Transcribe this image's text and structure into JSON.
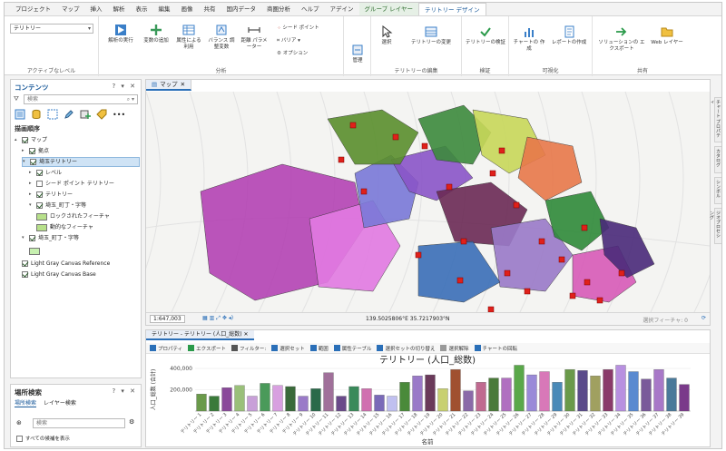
{
  "ribbon": {
    "tabs": [
      "プロジェクト",
      "マップ",
      "挿入",
      "解析",
      "表示",
      "編集",
      "画像",
      "共有",
      "国内データ",
      "商圏分析",
      "ヘルプ",
      "アデイン",
      "グループ レイヤー",
      "テリトリー デザイン"
    ],
    "active_tab": "テリトリー デザイン",
    "level_dropdown": "テリトリー",
    "level_group_label": "アクティブなレベル",
    "buttons": {
      "run_solve": "解析の実行",
      "add_variable": "変数の追加",
      "attribute_balance": "属性による 利用",
      "balance_variable": "バランス 調整変数",
      "distance_param": "距離 パラメーター",
      "seed_point": "シード ポイント",
      "barrier": "バリア",
      "options": "オプション",
      "manage": "管理",
      "select": "選択",
      "change_territory": "テリトリーの変更",
      "verify_territory": "テリトリーの検証",
      "create_chart": "チャートの 作成",
      "create_report": "レポートの作成",
      "export_solution": "ソリューションの エクスポート",
      "web_layer": "Web レイヤー"
    },
    "group_labels": {
      "analysis": "分析",
      "territory_edit": "テリトリーの編集",
      "verify": "検証",
      "visualize": "可視化",
      "share": "共有"
    }
  },
  "contents": {
    "title": "コンテンツ",
    "search_placeholder": "検索",
    "section": "描画順序",
    "items": [
      {
        "label": "マップ",
        "indent": 0,
        "checked": true,
        "twisty": "▴"
      },
      {
        "label": "拠点",
        "indent": 1,
        "checked": true,
        "twisty": "▸"
      },
      {
        "label": "埼玉テリトリー",
        "indent": 1,
        "checked": true,
        "twisty": "▾",
        "selected": true
      },
      {
        "label": "レベル",
        "indent": 2,
        "checked": true,
        "twisty": "▸"
      },
      {
        "label": "シード ポイント テリトリー",
        "indent": 2,
        "checked": false,
        "twisty": "▸"
      },
      {
        "label": "テリトリー",
        "indent": 2,
        "checked": true,
        "twisty": "▸"
      },
      {
        "label": "埼玉_町丁・字等",
        "indent": 2,
        "checked": true,
        "twisty": "▾"
      },
      {
        "label": "ロックされたフィーチャ",
        "indent": 3,
        "swatch": "#b7e08a"
      },
      {
        "label": "動的なフィーチャ",
        "indent": 3,
        "swatch": "#b7e08a"
      },
      {
        "label": "埼玉_町丁・字等",
        "indent": 1,
        "checked": true,
        "twisty": "▾"
      },
      {
        "label": "",
        "indent": 2,
        "swatch": "#c7f0b0"
      },
      {
        "label": "Light Gray Canvas Reference",
        "indent": 1,
        "checked": true
      },
      {
        "label": "Light Gray Canvas Base",
        "indent": 1,
        "checked": true
      }
    ]
  },
  "locate": {
    "title": "場所検索",
    "tabs": [
      "場所検索",
      "レイヤー検索"
    ],
    "search_placeholder": "検索",
    "show_all": "すべての候補を表示"
  },
  "map": {
    "tab_label": "マップ",
    "scale": "1:647,003",
    "coords": "139.5025806°E 35.7217903°N",
    "selected_features": "選択フィーチャ: 0"
  },
  "chart_view": {
    "tab_label": "テリトリー - テリトリー (人口_総数)",
    "toolbar": [
      "プロパティ",
      "エクスポート",
      "フィルター:",
      "選択セット",
      "範囲",
      "属性テーブル",
      "選択セットの切り替え",
      "選択解除",
      "チャートの回転"
    ]
  },
  "chart_data": {
    "type": "bar",
    "title": "テリトリー (人口_総数)",
    "xlabel": "名前",
    "ylabel": "人口_総数 (合計)",
    "ylim": [
      0,
      400000
    ],
    "yticks": [
      200000,
      400000
    ],
    "categories": [
      "テリトリー 1",
      "テリトリー 2",
      "テリトリー 3",
      "テリトリー 4",
      "テリトリー 5",
      "テリトリー 6",
      "テリトリー 7",
      "テリトリー 8",
      "テリトリー 9",
      "テリトリー 10",
      "テリトリー 11",
      "テリトリー 12",
      "テリトリー 13",
      "テリトリー 14",
      "テリトリー 15",
      "テリトリー 16",
      "テリトリー 17",
      "テリトリー 18",
      "テリトリー 19",
      "テリトリー 20",
      "テリトリー 21",
      "テリトリー 22",
      "テリトリー 23",
      "テリトリー 24",
      "テリトリー 25",
      "テリトリー 26",
      "テリトリー 27",
      "テリトリー 28",
      "テリトリー 29",
      "テリトリー 30",
      "テリトリー 31",
      "テリトリー 32",
      "テリトリー 33",
      "テリトリー 34",
      "テリトリー 35",
      "テリトリー 36",
      "テリトリー 37",
      "テリトリー 38",
      "テリトリー 39"
    ],
    "values": [
      160000,
      140000,
      220000,
      240000,
      140000,
      260000,
      240000,
      230000,
      140000,
      210000,
      360000,
      140000,
      230000,
      210000,
      150000,
      140000,
      270000,
      330000,
      340000,
      210000,
      390000,
      190000,
      270000,
      310000,
      310000,
      430000,
      340000,
      370000,
      270000,
      390000,
      380000,
      330000,
      390000,
      430000,
      370000,
      300000,
      390000,
      310000,
      250000
    ],
    "colors": [
      "#6a9a4a",
      "#3a7a3a",
      "#8a4a9a",
      "#9ac07a",
      "#c8a0d8",
      "#4a9a5a",
      "#d8a0e0",
      "#3a6a3a",
      "#9a7ac8",
      "#2a6a4a",
      "#a0709a",
      "#6a4a8a",
      "#3a8a5a",
      "#d070b0",
      "#7a6ab8",
      "#c0c0f0",
      "#4a8a3a",
      "#9a7ac8",
      "#6a3a5a",
      "#c8d070",
      "#a05030",
      "#8a6aa8",
      "#c06a90",
      "#4a7a3a",
      "#b070c0",
      "#5aa84a",
      "#9a8ad8",
      "#d878b8",
      "#4a8ab8",
      "#6a9a4a",
      "#5a4a8a",
      "#a0a060",
      "#8a3a6a",
      "#b890e0",
      "#5a8ad0",
      "#7a5a9a",
      "#a878c8",
      "#4a7a9a",
      "#7a3a8a"
    ]
  }
}
